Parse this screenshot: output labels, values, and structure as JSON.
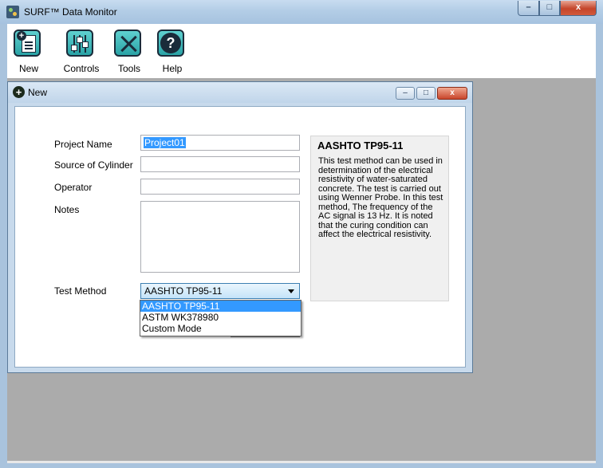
{
  "app": {
    "title": "SURF™ Data Monitor"
  },
  "window_controls": {
    "minimize": "–",
    "maximize": "□",
    "close": "x"
  },
  "toolbar": {
    "items": [
      {
        "label": "New",
        "icon": "new-document-icon"
      },
      {
        "label": "Controls",
        "icon": "sliders-icon"
      },
      {
        "label": "Tools",
        "icon": "tools-icon"
      },
      {
        "label": "Help",
        "icon": "help-icon"
      }
    ]
  },
  "child_window": {
    "title": "New",
    "controls": {
      "minimize": "–",
      "maximize": "□",
      "close": "x"
    }
  },
  "form": {
    "project_name": {
      "label": "Project Name",
      "value": "Project01"
    },
    "source": {
      "label": "Source of Cylinder",
      "value": ""
    },
    "operator": {
      "label": "Operator",
      "value": ""
    },
    "notes": {
      "label": "Notes",
      "value": ""
    },
    "test_method": {
      "label": "Test Method",
      "value": "AASHTO TP95-11",
      "options": [
        "AASHTO TP95-11",
        "ASTM WK378980",
        "Custom Mode"
      ]
    }
  },
  "info": {
    "title": "AASHTO TP95-11",
    "text": "This test method can be used in determination of the electrical resistivity of water-saturated concrete. The test is carried out using Wenner Probe. In this test method, The frequency of the AC signal is 13 Hz. It is noted that the curing condition can affect the electrical resistivity."
  }
}
